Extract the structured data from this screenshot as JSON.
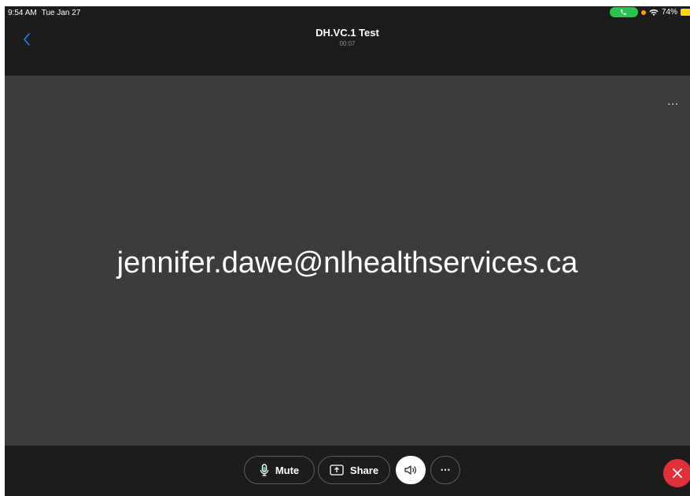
{
  "status_bar": {
    "time": "9:54 AM",
    "date": "Tue Jan 27",
    "battery": "74%"
  },
  "header": {
    "title": "DH.VC.1 Test",
    "timer": "00:07"
  },
  "stage": {
    "participant": "jennifer.dawe@nlhealthservices.ca",
    "more_label": "..."
  },
  "controls": {
    "mute_label": "Mute",
    "share_label": "Share",
    "more_label": "⋯"
  },
  "colors": {
    "background": "#1c1c1c",
    "stage": "#3c3c3c",
    "end_call": "#e0313a",
    "call_indicator": "#30c04f",
    "back_accent": "#2f7cf6"
  }
}
